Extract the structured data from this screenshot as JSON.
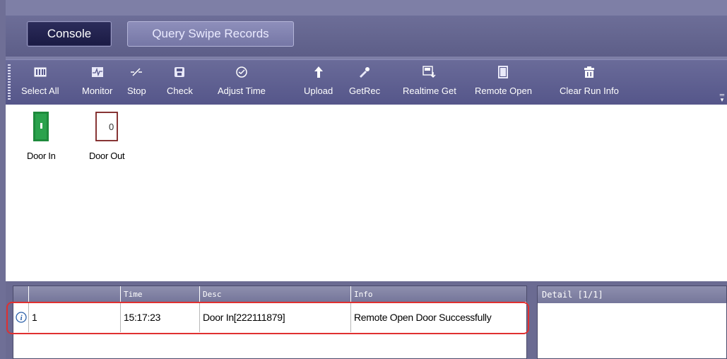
{
  "tabs": [
    {
      "label": "Console"
    },
    {
      "label": "Query Swipe Records"
    }
  ],
  "toolbar": {
    "items": [
      {
        "label": "Select All",
        "icon": "select-all-icon"
      },
      {
        "label": "Monitor",
        "icon": "monitor-icon"
      },
      {
        "label": "Stop",
        "icon": "stop-icon"
      },
      {
        "label": "Check",
        "icon": "check-icon"
      },
      {
        "label": "Adjust Time",
        "icon": "clock-icon"
      },
      {
        "label": "Upload",
        "icon": "upload-arrow-icon"
      },
      {
        "label": "GetRec",
        "icon": "get-record-icon"
      },
      {
        "label": "Realtime Get",
        "icon": "realtime-get-icon"
      },
      {
        "label": "Remote Open",
        "icon": "remote-open-icon"
      },
      {
        "label": "Clear Run Info",
        "icon": "trash-icon"
      }
    ]
  },
  "doors": [
    {
      "label": "Door In",
      "state": "open",
      "color": "#1e8a3c"
    },
    {
      "label": "Door Out",
      "state": "closed",
      "glyph": "0",
      "color": "#7a1f1f"
    }
  ],
  "log": {
    "columns": [
      "",
      "",
      "Time",
      "Desc",
      "Info"
    ],
    "rows": [
      {
        "icon": "info-icon",
        "num": "1",
        "time": "15:17:23",
        "desc": "Door In[222111879]",
        "info": "Remote Open Door Successfully"
      }
    ]
  },
  "detail": {
    "title": "Detail  [1/1]"
  }
}
